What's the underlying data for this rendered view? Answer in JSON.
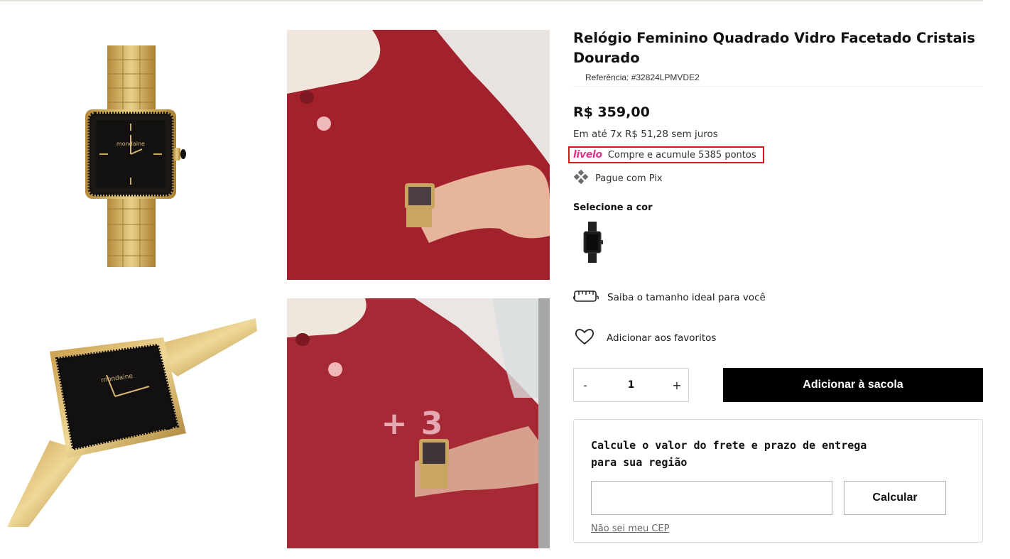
{
  "product": {
    "title": "Relógio Feminino Quadrado Vidro Facetado Cristais Dourado",
    "reference": "Referência: #32824LPMVDE2",
    "price": "R$ 359,00",
    "installments": "Em até 7x R$ 51,28 sem juros",
    "brand_on_dial": "mondaine"
  },
  "livelo": {
    "logo_text": "livelo",
    "text": "Compre e acumule 5385 pontos",
    "color": "#e0338e",
    "highlight_border": "#d21b1b"
  },
  "pix": {
    "text": "Pague com Pix",
    "icon": "pix-icon"
  },
  "color_selector": {
    "label": "Selecione a cor",
    "swatch": "black-watch"
  },
  "size_guide": {
    "text": "Saiba o tamanho ideal para você",
    "icon": "wrist-measure-icon"
  },
  "favorite": {
    "text": "Adicionar aos favoritos",
    "icon": "heart-icon"
  },
  "quantity": {
    "minus": "-",
    "value": "1",
    "plus": "+"
  },
  "cart": {
    "add_label": "Adicionar à sacola"
  },
  "shipping": {
    "title": "Calcule o valor do frete e prazo de entrega para sua região",
    "cep_placeholder": "",
    "calc_label": "Calcular",
    "cep_link": "Não sei meu CEP"
  },
  "gallery": {
    "more_count": "+ 3"
  }
}
